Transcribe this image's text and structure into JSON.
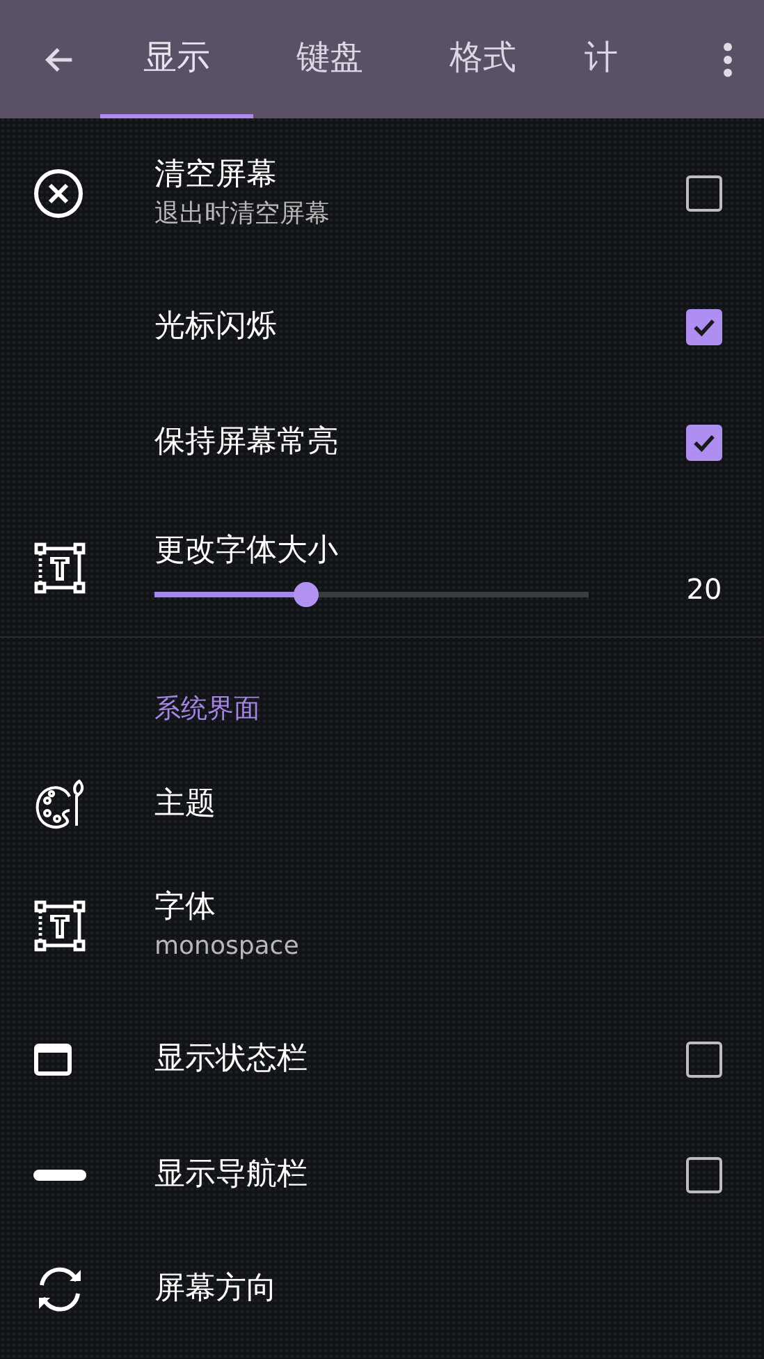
{
  "toolbar": {
    "tabs": [
      {
        "label": "显示",
        "selected": true
      },
      {
        "label": "键盘",
        "selected": false
      },
      {
        "label": "格式",
        "selected": false
      },
      {
        "label": "计",
        "selected": false
      }
    ]
  },
  "sections": [
    {
      "items": [
        {
          "kind": "checkbox",
          "title": "清空屏幕",
          "subtitle": "退出时清空屏幕",
          "checked": false
        },
        {
          "kind": "checkbox",
          "title": "光标闪烁",
          "checked": true
        },
        {
          "kind": "checkbox",
          "title": "保持屏幕常亮",
          "checked": true
        },
        {
          "kind": "slider",
          "title": "更改字体大小",
          "level": 0.33,
          "reading": "20"
        }
      ]
    },
    {
      "header": "系统界面",
      "items": [
        {
          "kind": "plain",
          "title": "主题"
        },
        {
          "kind": "plain",
          "title": "字体",
          "subtitle": "monospace"
        },
        {
          "kind": "checkbox",
          "title": "显示状态栏",
          "checked": false
        },
        {
          "kind": "checkbox",
          "title": "显示导航栏",
          "checked": false
        },
        {
          "kind": "plain",
          "title": "屏幕方向"
        }
      ]
    }
  ]
}
